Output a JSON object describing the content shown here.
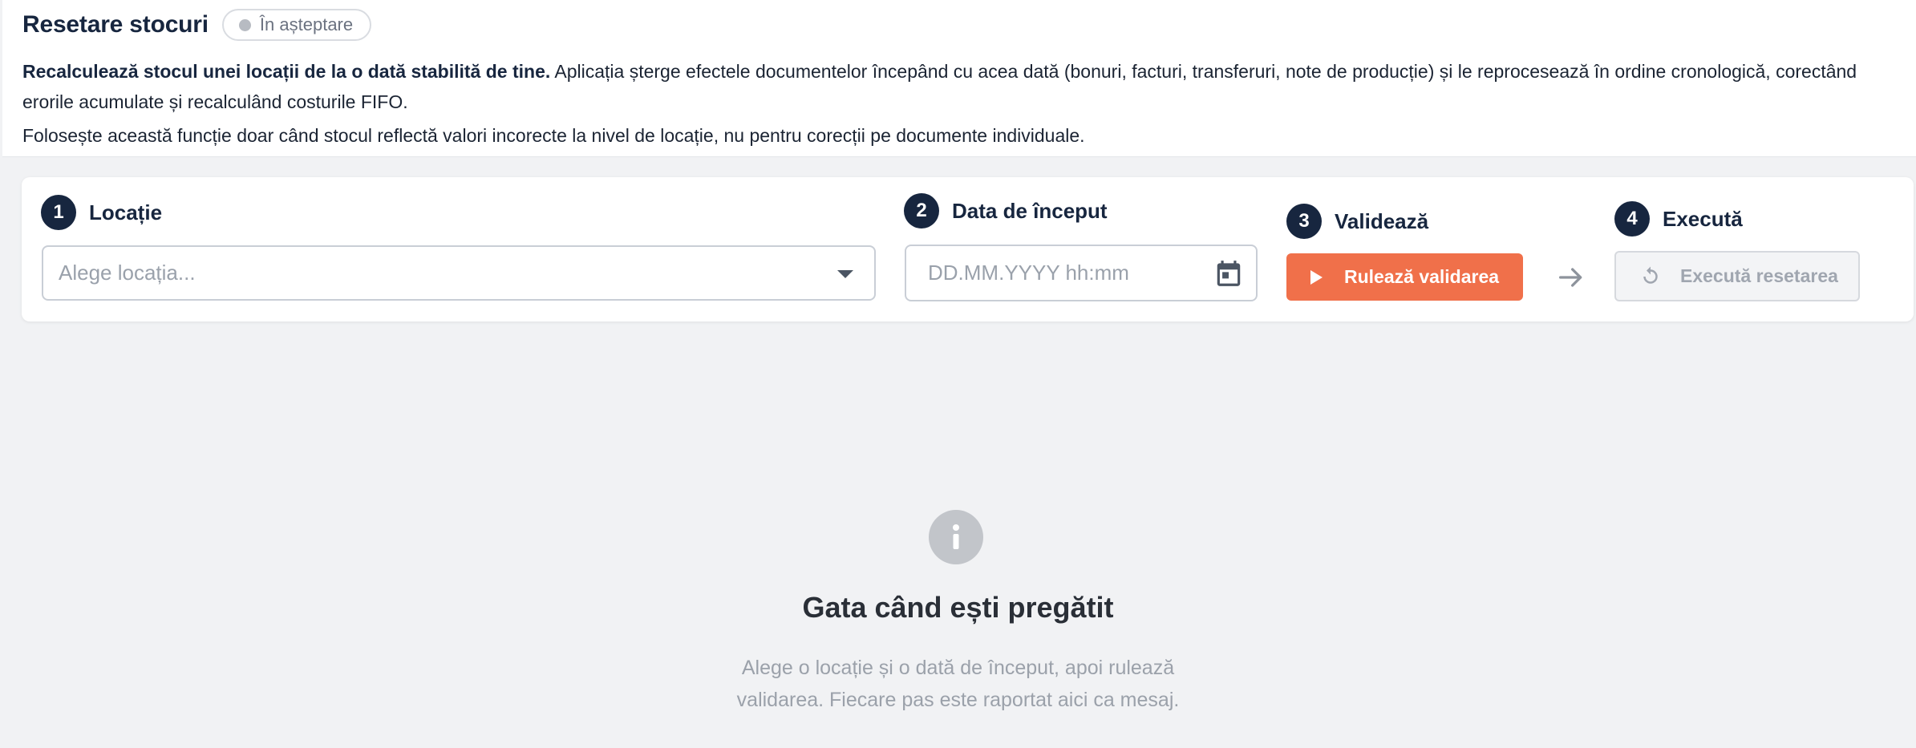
{
  "header": {
    "title": "Resetare stocuri",
    "status": "În așteptare",
    "description_bold": "Recalculează stocul unei locații de la o dată stabilită de tine.",
    "description_rest": " Aplicația șterge efectele documentelor începând cu acea dată (bonuri, facturi, transferuri, note de producție) și le reprocesează în ordine cronologică, corectând erorile acumulate și recalculând costurile FIFO.",
    "note": "Folosește această funcție doar când stocul reflectă valori incorecte la nivel de locație, nu pentru corecții pe documente individuale."
  },
  "steps": [
    {
      "number": "1",
      "label": "Locație"
    },
    {
      "number": "2",
      "label": "Data de început"
    },
    {
      "number": "3",
      "label": "Validează"
    },
    {
      "number": "4",
      "label": "Execută"
    }
  ],
  "location_select": {
    "placeholder": "Alege locația..."
  },
  "start_date": {
    "placeholder": "DD.MM.YYYY hh:mm"
  },
  "buttons": {
    "run_validation": "Rulează validarea",
    "execute_reset": "Execută resetarea"
  },
  "empty_state": {
    "title": "Gata când ești pregătit",
    "line1": "Alege o locație și o dată de început, apoi rulează",
    "line2": "validarea. Fiecare pas este raportat aici ca mesaj."
  },
  "colors": {
    "primary_dark": "#17263f",
    "accent": "#f0704a",
    "muted": "#9ba1aa"
  },
  "icons": [
    "calendar-icon",
    "play-icon",
    "arrow-right-icon",
    "reset-icon",
    "info-icon",
    "chevron-down-icon"
  ]
}
